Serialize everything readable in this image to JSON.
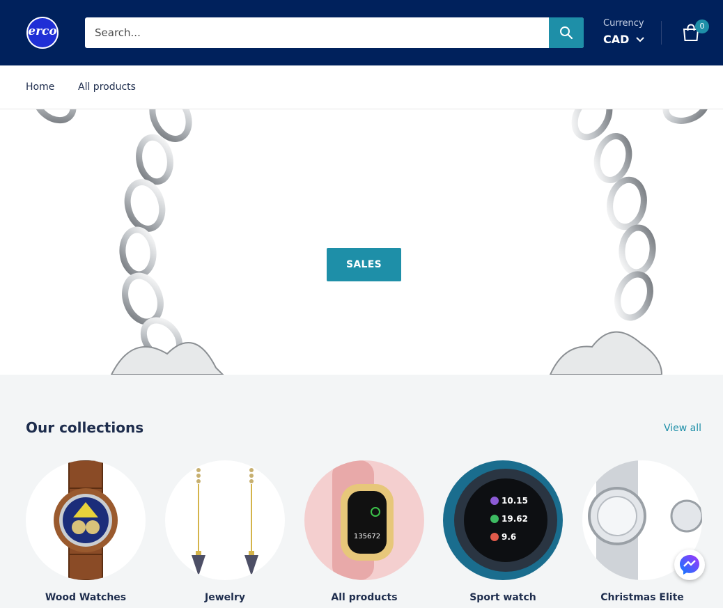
{
  "header": {
    "logo_text": "erco",
    "search_placeholder": "Search...",
    "currency_label": "Currency",
    "currency_value": "CAD",
    "cart_count": "0"
  },
  "nav": {
    "items": [
      {
        "label": "Home"
      },
      {
        "label": "All products"
      }
    ]
  },
  "hero": {
    "button_label": "SALES"
  },
  "collections": {
    "title": "Our collections",
    "view_all": "View all",
    "items": [
      {
        "name": "Wood Watches"
      },
      {
        "name": "Jewelry"
      },
      {
        "name": "All products"
      },
      {
        "name": "Sport watch"
      },
      {
        "name": "Christmas Elite"
      }
    ]
  },
  "colors": {
    "header_bg": "#00215c",
    "accent": "#1e8fa8",
    "text_dark": "#1e2d4d"
  }
}
